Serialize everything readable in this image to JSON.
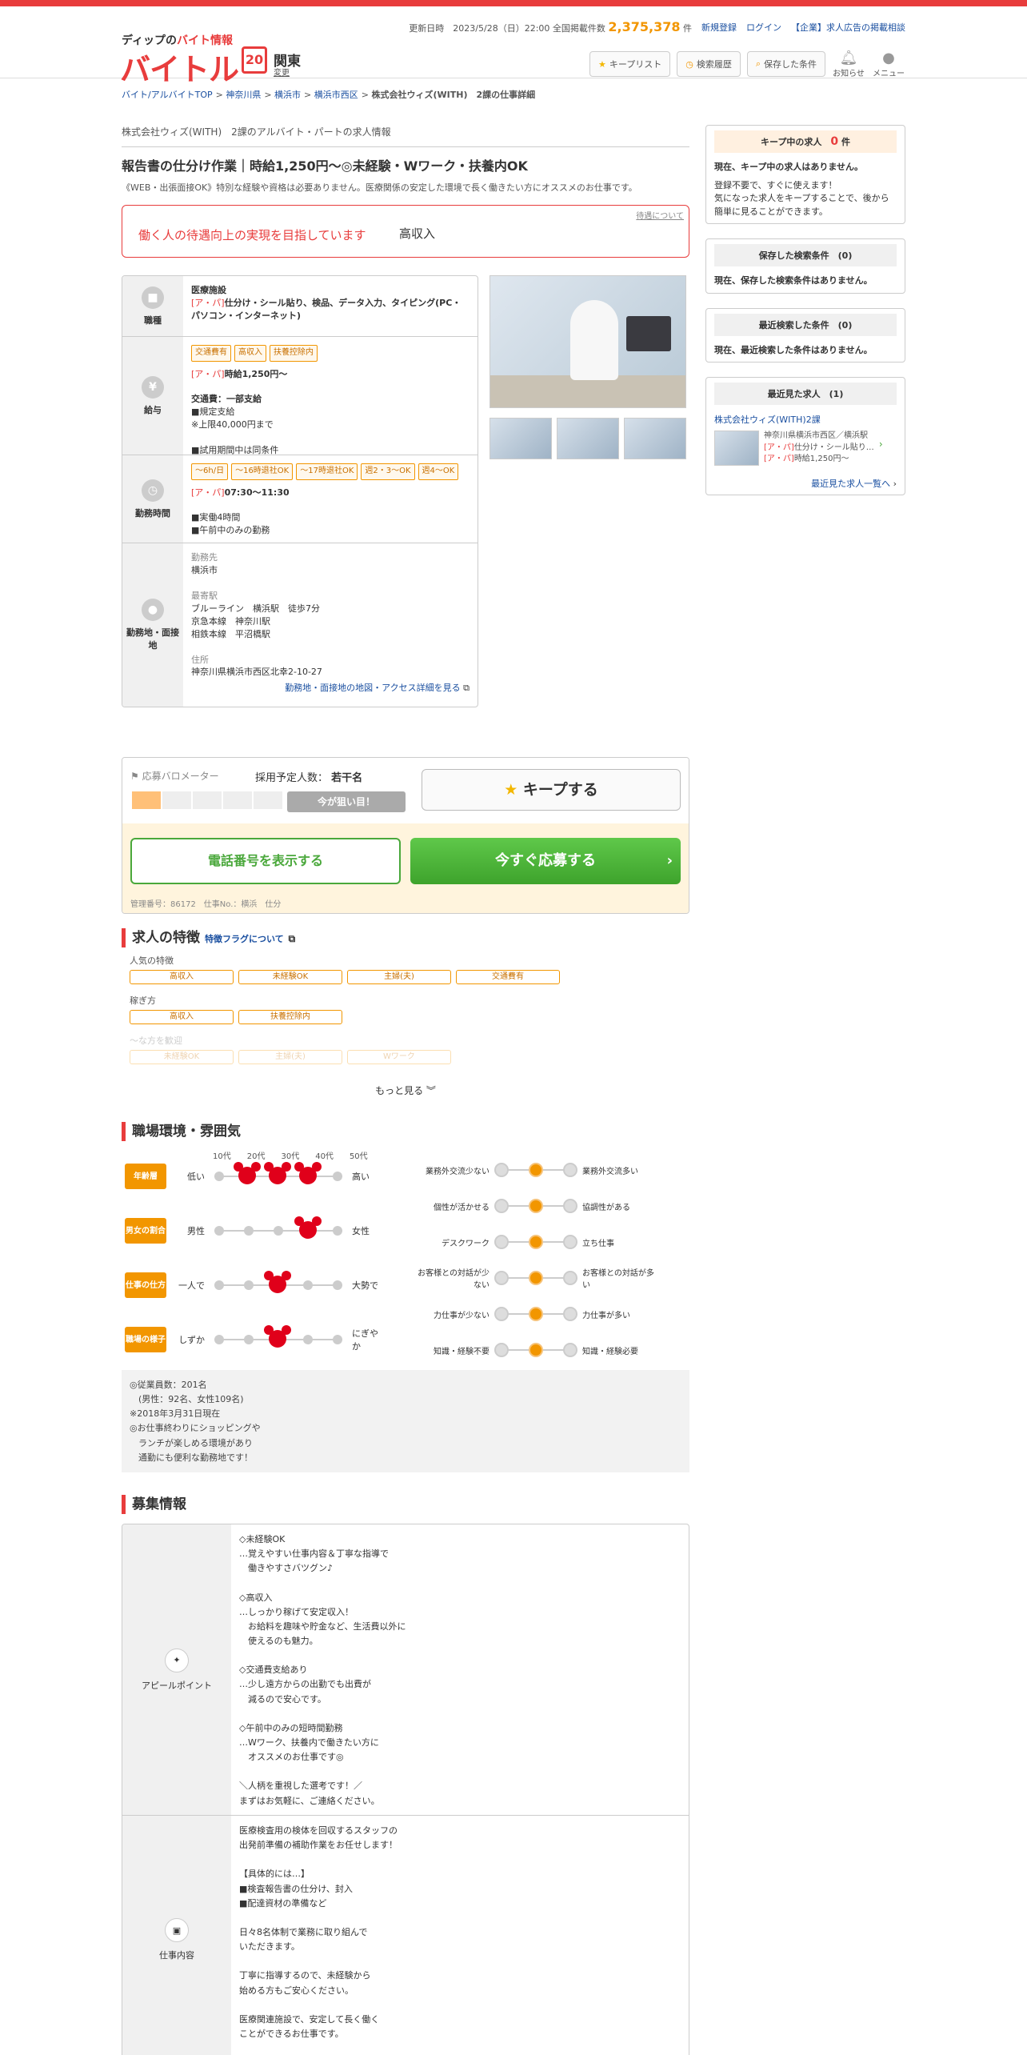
{
  "header": {
    "logo_tagline_a": "ディップの",
    "logo_tagline_b": "バイト情報",
    "logo": "バイトル",
    "logo_20": "20",
    "region": "関東",
    "region_change": "変更",
    "updated": "更新日時　2023/5/28（日）22:00 全国掲載件数",
    "count": "2,375,378",
    "count_unit": "件",
    "register": "新規登録",
    "login": "ログイン",
    "corp_link": "【企業】求人広告の掲載相談",
    "btn_keep": "キープリスト",
    "btn_history": "検索履歴",
    "btn_saved": "保存した条件",
    "notice": "お知らせ",
    "menu": "メニュー"
  },
  "breadcrumb": [
    "バイト/アルバイトTOP",
    "神奈川県",
    "横浜市",
    "横浜市西区"
  ],
  "breadcrumb_current": "株式会社ウィズ(WITH)　2課の仕事詳細",
  "job": {
    "company": "株式会社ウィズ(WITH)　2課のアルバイト・パートの求人情報",
    "title": "報告書の仕分け作業｜時給1,250円～◎未経験・Wワーク・扶養内OK",
    "subtitle": "《WEB・出張面接OK》特別な経験や資格は必要ありません。医療関係の安定した環境で長く働きたい方にオススメのお仕事です。",
    "pr_link": "待遇について",
    "pr_left": "働く人の待遇向上の実現を目指しています",
    "pr_right": "高収入"
  },
  "info": {
    "shokushu": {
      "label": "職種",
      "l1": "医療施設",
      "prefix": "[ア・パ]",
      "l2": "仕分け・シール貼り、検品、データ入力、タイピング(PC・パソコン・インターネット)"
    },
    "kyuyo": {
      "label": "給与",
      "tags": [
        "交通費有",
        "高収入",
        "扶養控除内"
      ],
      "prefix": "[ア・パ]",
      "wage": "時給1,250円～",
      "l1": "交通費：一部支給",
      "l2": "■規定支給",
      "l3": "※上限40,000円まで",
      "l4": "■試用期間中は同条件"
    },
    "jikan": {
      "label": "勤務時間",
      "tags": [
        "～6h/日",
        "～16時退社OK",
        "～17時退社OK",
        "週2・3～OK",
        "週4～OK"
      ],
      "prefix": "[ア・パ]",
      "time": "07:30～11:30",
      "l1": "■実働4時間",
      "l2": "■午前中のみの勤務"
    },
    "basho": {
      "label": "勤務地・面接地",
      "h1": "勤務先",
      "v1": "横浜市",
      "h2": "最寄駅",
      "v2a": "ブルーライン　横浜駅　徒歩7分",
      "v2b": "京急本線　神奈川駅",
      "v2c": "相鉄本線　平沼橋駅",
      "h3": "住所",
      "v3": "神奈川県横浜市西区北幸2-10-27",
      "map": "勤務地・面接地の地図・アクセス詳細を見る"
    }
  },
  "apply": {
    "meter_label": "応募バロメーター",
    "hire_label": "採用予定人数：",
    "hire_value": "若干名",
    "meter_msg": "今が狙い目！",
    "meter_level": 1,
    "keep": "キープする",
    "tel": "電話番号を表示する",
    "go": "今すぐ応募する",
    "mgmt": "管理番号：86172　仕事No.：横浜　仕分"
  },
  "features": {
    "title": "求人の特徴",
    "link": "特徴フラグについて",
    "c1": "人気の特徴",
    "r1": [
      "高収入",
      "未経験OK",
      "主婦(夫)",
      "交通費有"
    ],
    "c2": "稼ぎ方",
    "r2": [
      "高収入",
      "扶養控除内"
    ],
    "c3": "～な方を歓迎",
    "r3": [
      "未経験OK",
      "主婦(夫)",
      "Wワーク"
    ],
    "more": "もっと見る"
  },
  "env": {
    "title": "職場環境・雰囲気",
    "ages": [
      "10代",
      "20代",
      "30代",
      "40代",
      "50代"
    ],
    "left": [
      {
        "badge": "年齢層",
        "l": "低い",
        "r": "高い"
      },
      {
        "badge": "男女の割合",
        "l": "男性",
        "r": "女性"
      },
      {
        "badge": "仕事の仕方",
        "l": "一人で",
        "r": "大勢で"
      },
      {
        "badge": "職場の様子",
        "l": "しずか",
        "r": "にぎやか"
      }
    ],
    "right": [
      {
        "l": "業務外交流少ない",
        "r": "業務外交流多い"
      },
      {
        "l": "個性が活かせる",
        "r": "協調性がある"
      },
      {
        "l": "デスクワーク",
        "r": "立ち仕事"
      },
      {
        "l": "お客様との対話が少ない",
        "r": "お客様との対話が多い"
      },
      {
        "l": "力仕事が少ない",
        "r": "力仕事が多い"
      },
      {
        "l": "知識・経験不要",
        "r": "知識・経験必要"
      }
    ],
    "note": "◎従業員数：201名\n　(男性：92名、女性109名)\n※2018年3月31日現在\n◎お仕事終わりにショッピングや\n　ランチが楽しめる環境があり\n　通勤にも便利な勤務地です！"
  },
  "recruit": {
    "title": "募集情報",
    "appeal_label": "アピールポイント",
    "appeal": "◇未経験OK\n…覚えやすい仕事内容＆丁寧な指導で\n　働きやすさバツグン♪\n\n◇高収入\n…しっかり稼げて安定収入！\n　お給料を趣味や貯金など、生活費以外に\n　使えるのも魅力。\n\n◇交通費支給あり\n…少し遠方からの出勤でも出費が\n　減るので安心です。\n\n◇午前中のみの短時間勤務\n…Wワーク、扶養内で働きたい方に\n　オススメのお仕事です◎\n\n＼人柄を重視した選考です！／\nまずはお気軽に、ご連絡ください。",
    "work_label": "仕事内容",
    "work": "医療検査用の検体を回収するスタッフの\n出発前準備の補助作業をお任せします！\n\n【具体的には…】\n■検査報告書の仕分け、封入\n■配達資材の準備など\n\n日々8名体制で業務に取り組んで\nいただきます。\n\n丁寧に指導するので、未経験から\n始める方もご安心ください。\n\n医療関連施設で、安定して長く働く\nことができるお仕事です。"
  },
  "side": {
    "keep_title": "キープ中の求人",
    "keep_count": "0",
    "keep_unit": "件",
    "keep_t1": "現在、キープ中の求人はありません。",
    "keep_t2": "登録不要で、すぐに使えます！\n気になった求人をキープすることで、後から簡単に見ることができます。",
    "saved_title": "保存した検索条件　(0)",
    "saved_t": "現在、保存した検索条件はありません。",
    "recent_s_title": "最近検索した条件　(0)",
    "recent_s_t": "現在、最近検索した条件はありません。",
    "recent_v_title": "最近見た求人　(1)",
    "recent_co": "株式会社ウィズ(WITH)2課",
    "recent_l1": "神奈川県横浜市西区／横浜駅",
    "recent_prefix": "[ア・パ]",
    "recent_l2": "仕分け・シール貼り…",
    "recent_l3": "時給1,250円～",
    "recent_more": "最近見た求人一覧へ"
  }
}
